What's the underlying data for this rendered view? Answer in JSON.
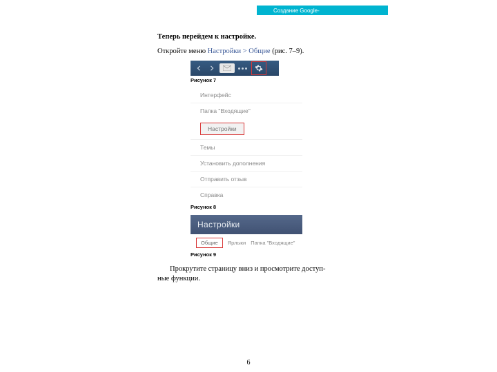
{
  "header": {
    "title": "Создание Google-"
  },
  "intro": {
    "bold_line": "Теперь перейдем к настройке.",
    "line2_prefix": "Откройте меню ",
    "line2_link": "Настройки > Общие",
    "line2_suffix": " (рис. 7–9)."
  },
  "figure7": {
    "caption": "Рисунок 7"
  },
  "figure8": {
    "caption": "Рисунок 8",
    "items_top": [
      "Интерфейс",
      "Папка \"Входящие\""
    ],
    "highlight": "Настройки",
    "items_mid": [
      "Темы"
    ],
    "items_bottom": [
      "Установить дополнения",
      "Отправить отзыв",
      "Справка"
    ]
  },
  "figure9": {
    "caption": "Рисунок 9",
    "header": "Настройки",
    "tab_active": "Общие",
    "tabs_rest": [
      "Ярлыки",
      "Папка \"Входящие\""
    ]
  },
  "end_para": "Прокрутите страницу вниз и просмотрите доступ-\nные функции.",
  "page_number": "6"
}
